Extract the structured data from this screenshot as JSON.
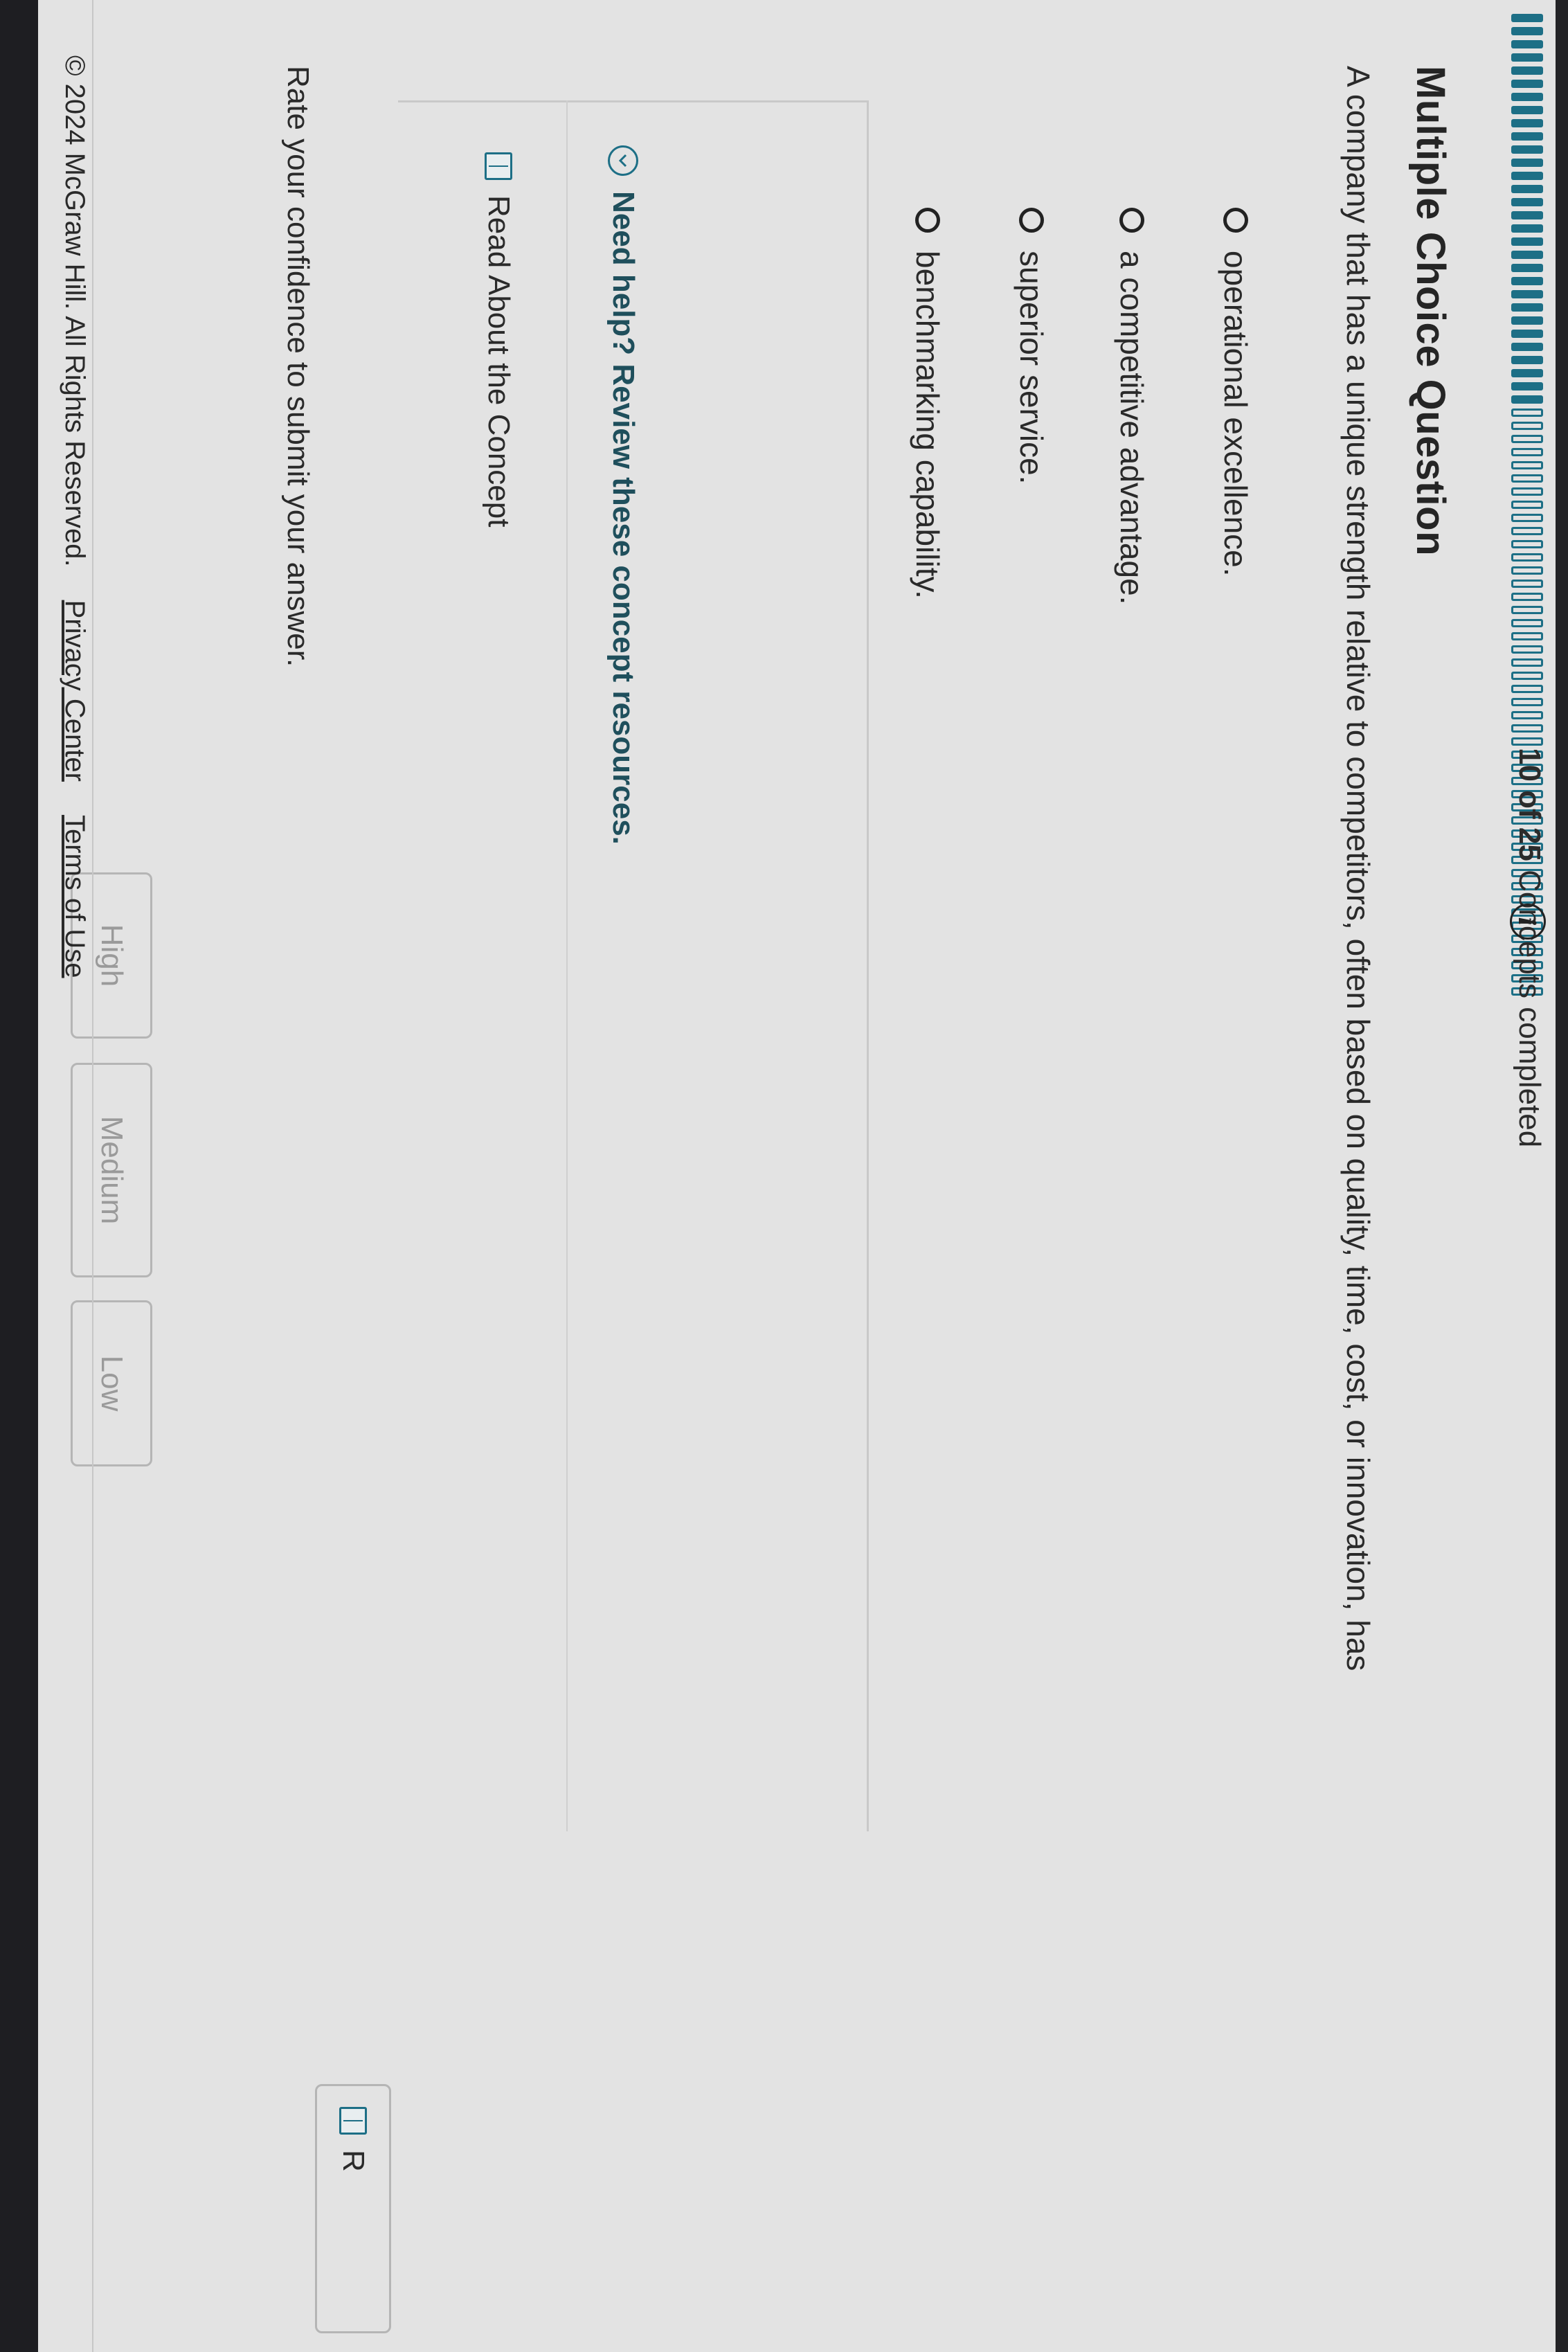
{
  "progress": {
    "completed": 10,
    "total": 25,
    "count_label": "10 of 25",
    "suffix_label": "Concepts completed",
    "info_glyph": "i",
    "accent_color": "#1d6f86"
  },
  "question": {
    "title": "Multiple Choice Question",
    "text": "A company that has a unique strength relative to competitors, often based on quality, time, cost, or innovation, has",
    "options": [
      {
        "label": "operational excellence."
      },
      {
        "label": "a competitive advantage."
      },
      {
        "label": "superior service."
      },
      {
        "label": "benchmarking capability."
      }
    ]
  },
  "help": {
    "toggle_text": "Need help? Review these concept resources.",
    "resource_label": "Read About the Concept"
  },
  "confidence": {
    "prompt": "Rate your confidence to submit your answer.",
    "buttons": [
      "High",
      "Medium",
      "Low"
    ]
  },
  "footer": {
    "copyright": "© 2024 McGraw Hill. All Rights Reserved.",
    "privacy_link": "Privacy Center",
    "terms_link": "Terms of Use"
  },
  "side_button": {
    "label": "R"
  }
}
